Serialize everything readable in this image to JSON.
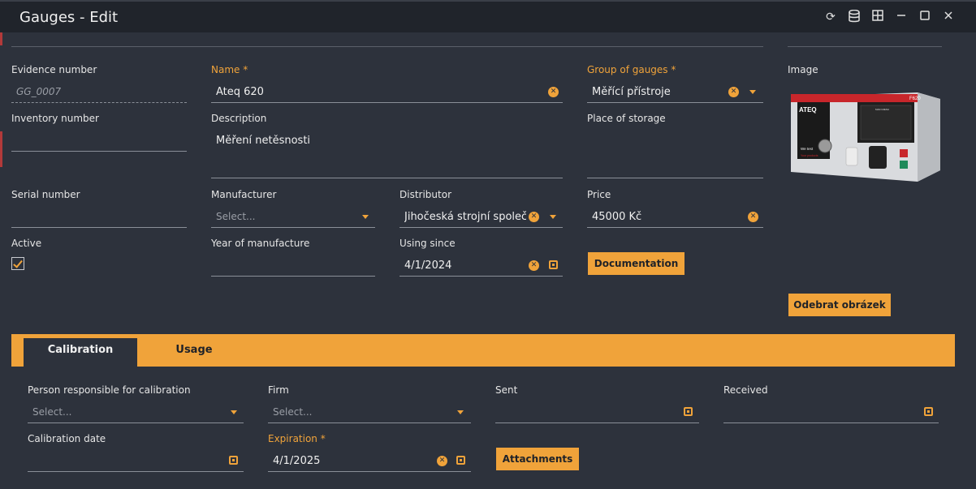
{
  "window": {
    "title": "Gauges - Edit"
  },
  "fields": {
    "evidence_number": {
      "label": "Evidence number",
      "value": "GG_0007"
    },
    "name": {
      "label": "Name *",
      "value": "Ateq 620"
    },
    "group_of_gauges": {
      "label": "Group of gauges *",
      "value": "Měřící přístroje"
    },
    "image": {
      "label": "Image"
    },
    "inventory_number": {
      "label": "Inventory number",
      "value": ""
    },
    "description": {
      "label": "Description",
      "value": "Měření netěsnosti"
    },
    "place_of_storage": {
      "label": "Place of storage",
      "value": ""
    },
    "serial_number": {
      "label": "Serial number",
      "value": ""
    },
    "manufacturer": {
      "label": "Manufacturer",
      "placeholder": "Select..."
    },
    "distributor": {
      "label": "Distributor",
      "value": "Jihočeská strojní společ..."
    },
    "price": {
      "label": "Price",
      "value": "45000 Kč"
    },
    "active": {
      "label": "Active",
      "checked": true
    },
    "year_of_manufacture": {
      "label": "Year of manufacture",
      "value": ""
    },
    "using_since": {
      "label": "Using since",
      "value": "4/1/2024"
    }
  },
  "buttons": {
    "documentation": "Documentation",
    "remove_image": "Odebrat obrázek",
    "attachments": "Attachments"
  },
  "tabs": [
    {
      "label": "Calibration",
      "active": true
    },
    {
      "label": "Usage",
      "active": false
    }
  ],
  "calibration": {
    "person_responsible": {
      "label": "Person responsible for calibration",
      "placeholder": "Select..."
    },
    "firm": {
      "label": "Firm",
      "placeholder": "Select..."
    },
    "sent": {
      "label": "Sent",
      "value": ""
    },
    "received": {
      "label": "Received",
      "value": ""
    },
    "calibration_date": {
      "label": "Calibration date",
      "value": ""
    },
    "expiration": {
      "label": "Expiration *",
      "value": "4/1/2025"
    }
  },
  "device_image": {
    "brand": "ATEQ",
    "model": "F620",
    "screen_title": "MAIN MENU",
    "panel_text": "We test",
    "panel_subtext": "Your products"
  },
  "colors": {
    "accent": "#f0a33a",
    "background": "#2d323c",
    "titlebar": "#20242b"
  }
}
